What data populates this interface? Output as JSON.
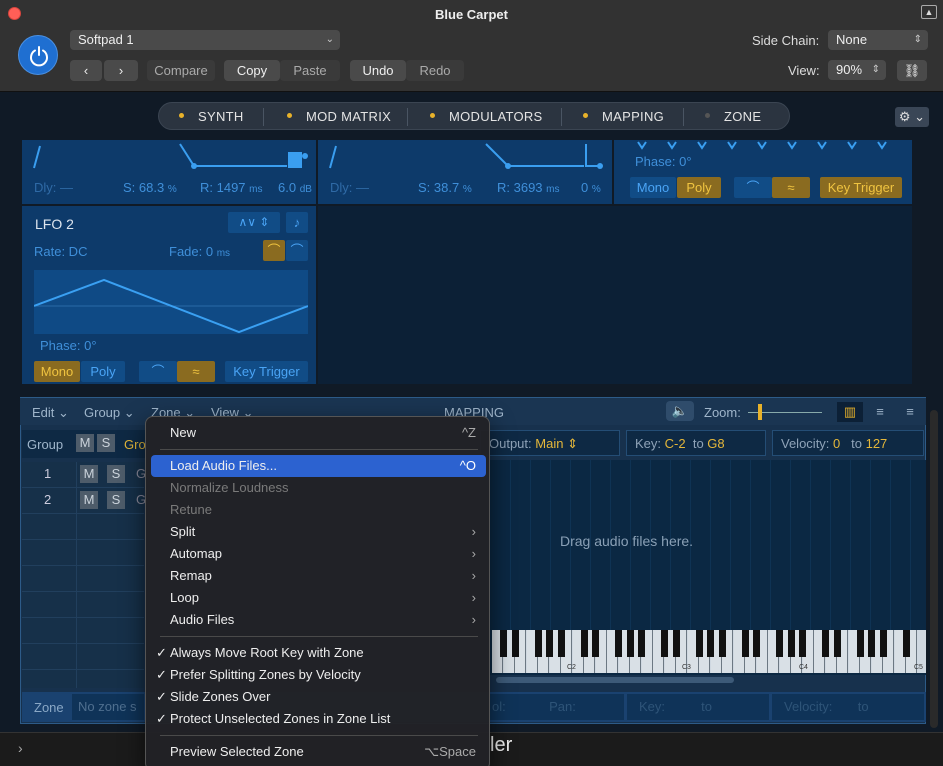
{
  "window": {
    "title": "Blue Carpet"
  },
  "header": {
    "preset": "Softpad 1",
    "compare": "Compare",
    "copy": "Copy",
    "paste": "Paste",
    "undo": "Undo",
    "redo": "Redo",
    "side_chain_label": "Side Chain:",
    "side_chain_value": "None",
    "view_label": "View:",
    "view_value": "90%"
  },
  "tabs": [
    "SYNTH",
    "MOD MATRIX",
    "MODULATORS",
    "MAPPING",
    "ZONE"
  ],
  "env1": {
    "dly": "Dly: —",
    "s": "S: 68.3",
    "s_unit": "%",
    "r": "R: 1497",
    "r_unit": "ms",
    "level": "6.0",
    "level_unit": "dB"
  },
  "env2": {
    "dly": "Dly: —",
    "s": "S: 38.7",
    "s_unit": "%",
    "r": "R: 3693",
    "r_unit": "ms",
    "level": "0",
    "level_unit": "%"
  },
  "lfo1": {
    "phase": "Phase: 0°",
    "mono": "Mono",
    "poly": "Poly",
    "key_trigger": "Key Trigger"
  },
  "lfo2": {
    "title": "LFO 2",
    "rate": "Rate: DC",
    "fade": "Fade: 0",
    "fade_unit": "ms",
    "phase": "Phase: 0°",
    "mono": "Mono",
    "poly": "Poly",
    "key_trigger": "Key Trigger"
  },
  "mapping": {
    "menus": [
      "Edit",
      "Group",
      "Zone",
      "View"
    ],
    "title": "MAPPING",
    "zoom_label": "Zoom:",
    "group_label": "Group",
    "m": "M",
    "s": "S",
    "group_name_short": "Gro",
    "group_row_cut": "G",
    "rows": [
      "1",
      "2"
    ],
    "output_label": "Output:",
    "output_value": "Main",
    "key_label": "Key:",
    "key_from": "C-2",
    "key_to_label": "to",
    "key_to": "G8",
    "velocity_label": "Velocity:",
    "velocity_from": "0",
    "velocity_to_label": "to",
    "velocity_to": "127",
    "drag_hint": "Drag audio files here.",
    "octave_labels": [
      "C2",
      "C3",
      "C4",
      "C5"
    ],
    "zone_label": "Zone",
    "no_zone": "No zone s",
    "bottom_fields": [
      "ol:",
      "Pan:",
      "Key:",
      "to",
      "Velocity:",
      "to"
    ]
  },
  "context_menu": {
    "items": [
      {
        "label": "New",
        "shortcut": "^Z"
      },
      {
        "label": "Load Audio Files...",
        "shortcut": "^O",
        "highlighted": true
      },
      {
        "label": "Normalize Loudness",
        "disabled": true
      },
      {
        "label": "Retune",
        "disabled": true
      },
      {
        "label": "Split",
        "submenu": true
      },
      {
        "label": "Automap",
        "submenu": true
      },
      {
        "label": "Remap",
        "submenu": true
      },
      {
        "label": "Loop",
        "submenu": true
      },
      {
        "label": "Audio Files",
        "submenu": true
      },
      {
        "label": "Always Move Root Key with Zone",
        "checked": true
      },
      {
        "label": "Prefer Splitting Zones by Velocity",
        "checked": true
      },
      {
        "label": "Slide Zones Over",
        "checked": true
      },
      {
        "label": "Protect Unselected Zones in Zone List",
        "checked": true
      },
      {
        "label": "Preview Selected Zone",
        "shortcut": "⌥Space"
      }
    ],
    "submenu_arrow": "›",
    "checkmark": "✓"
  },
  "footer": {
    "partial_text": "ler"
  },
  "colors": {
    "accent_blue": "#1f6fd1",
    "menu_highlight": "#2c62d0",
    "active_yellow": "#e8b22a",
    "panel_blue": "#0d3a6a"
  }
}
